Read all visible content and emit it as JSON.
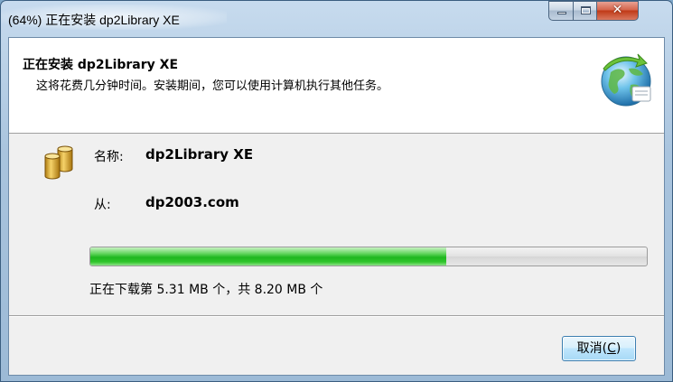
{
  "window": {
    "title": "(64%) 正在安装 dp2Library XE",
    "controls": {
      "minimize": "minimize-icon",
      "maximize": "maximize-icon",
      "close": "✕"
    }
  },
  "header": {
    "title": "正在安装 dp2Library XE",
    "subtitle": "这将花费几分钟时间。安装期间，您可以使用计算机执行其他任务。",
    "icon": "globe-install-icon"
  },
  "details": {
    "icon": "database-icon",
    "name_label": "名称:",
    "name_value": "dp2Library XE",
    "from_label": "从:",
    "from_value": "dp2003.com"
  },
  "progress": {
    "fraction": 0.64,
    "status": "正在下载第 5.31 MB 个，共 8.20 MB 个",
    "fill_color": "#2fc62b"
  },
  "footer": {
    "cancel_label": "取消(",
    "cancel_accel": "C",
    "cancel_tail": ")"
  }
}
